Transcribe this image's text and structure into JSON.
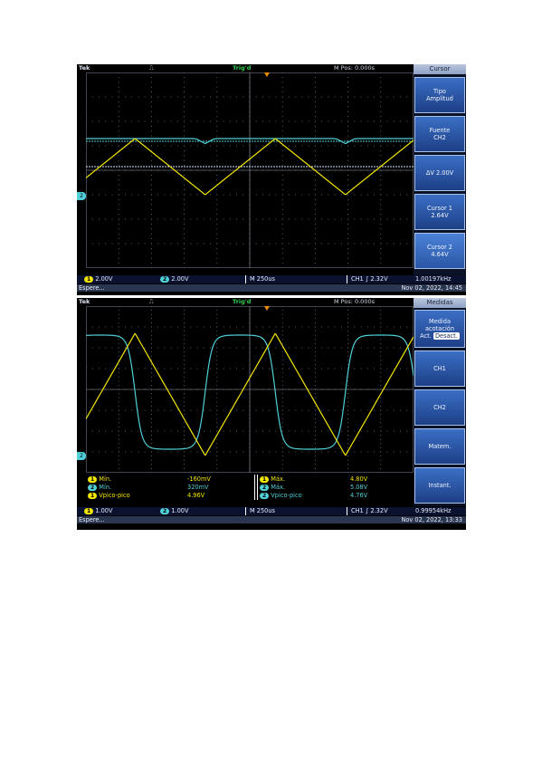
{
  "scopes": [
    {
      "brand": "Tek",
      "trigger_state": "Trig'd",
      "trigger_icon": "rising-edge-icon",
      "m_pos": "M Pos: 0.000s",
      "menu": {
        "title": "Cursor",
        "buttons": [
          {
            "line1": "Tipo",
            "line2": "Amplitud"
          },
          {
            "line1": "Fuente",
            "line2": "CH2"
          },
          {
            "line1": "ΔV 2.00V",
            "line2": ""
          },
          {
            "line1": "Cursor 1",
            "line2": "2.64V"
          },
          {
            "line1": "Cursor 2",
            "line2": "4.64V"
          }
        ]
      },
      "status": {
        "ch1_num": "1",
        "ch1_scale": "2.00V",
        "ch2_num": "2",
        "ch2_scale": "2.00V",
        "timebase": "M 250us",
        "trigger": "CH1 ∫ 2.32V",
        "frequency": "1.00197kHz"
      },
      "footer": {
        "left": "Espere...",
        "right": "Nov 02, 2022, 14:45"
      }
    },
    {
      "brand": "Tek",
      "trigger_state": "Trig'd",
      "trigger_icon": "rising-edge-icon",
      "m_pos": "M Pos: 0.000s",
      "menu": {
        "title": "Medidas",
        "buttons": [
          {
            "line1": "Medida",
            "line2": "acotación",
            "line3": "Act.",
            "line3b": "Desact."
          },
          {
            "line1": "CH1",
            "line2": ""
          },
          {
            "line1": "CH2",
            "line2": ""
          },
          {
            "line1": "Matem.",
            "line2": ""
          },
          {
            "line1": "Instant.",
            "line2": ""
          }
        ]
      },
      "measurements": {
        "left": [
          {
            "ch": "1",
            "label": "Mín.",
            "value": "-160mV"
          },
          {
            "ch": "2",
            "label": "Mín.",
            "value": "320mV"
          },
          {
            "ch": "1",
            "label": "Vpico-pico",
            "value": "4.96V"
          }
        ],
        "right": [
          {
            "ch": "1",
            "label": "Máx.",
            "value": "4.80V"
          },
          {
            "ch": "2",
            "label": "Máx.",
            "value": "5.08V"
          },
          {
            "ch": "2",
            "label": "Vpico-pico",
            "value": "4.76V"
          }
        ]
      },
      "status": {
        "ch1_num": "1",
        "ch1_scale": "1.00V",
        "ch2_num": "2",
        "ch2_scale": "1.00V",
        "timebase": "M 250us",
        "trigger": "CH1 ∫ 2.32V",
        "frequency": "0.99954kHz"
      },
      "footer": {
        "left": "Espere...",
        "right": "Nov 02, 2022, 13:33"
      }
    }
  ],
  "colors": {
    "ch1": "#f2e500",
    "ch2": "#50d0d8",
    "grid": "#8a8f9c",
    "cursor": "#cfe4ff"
  }
}
